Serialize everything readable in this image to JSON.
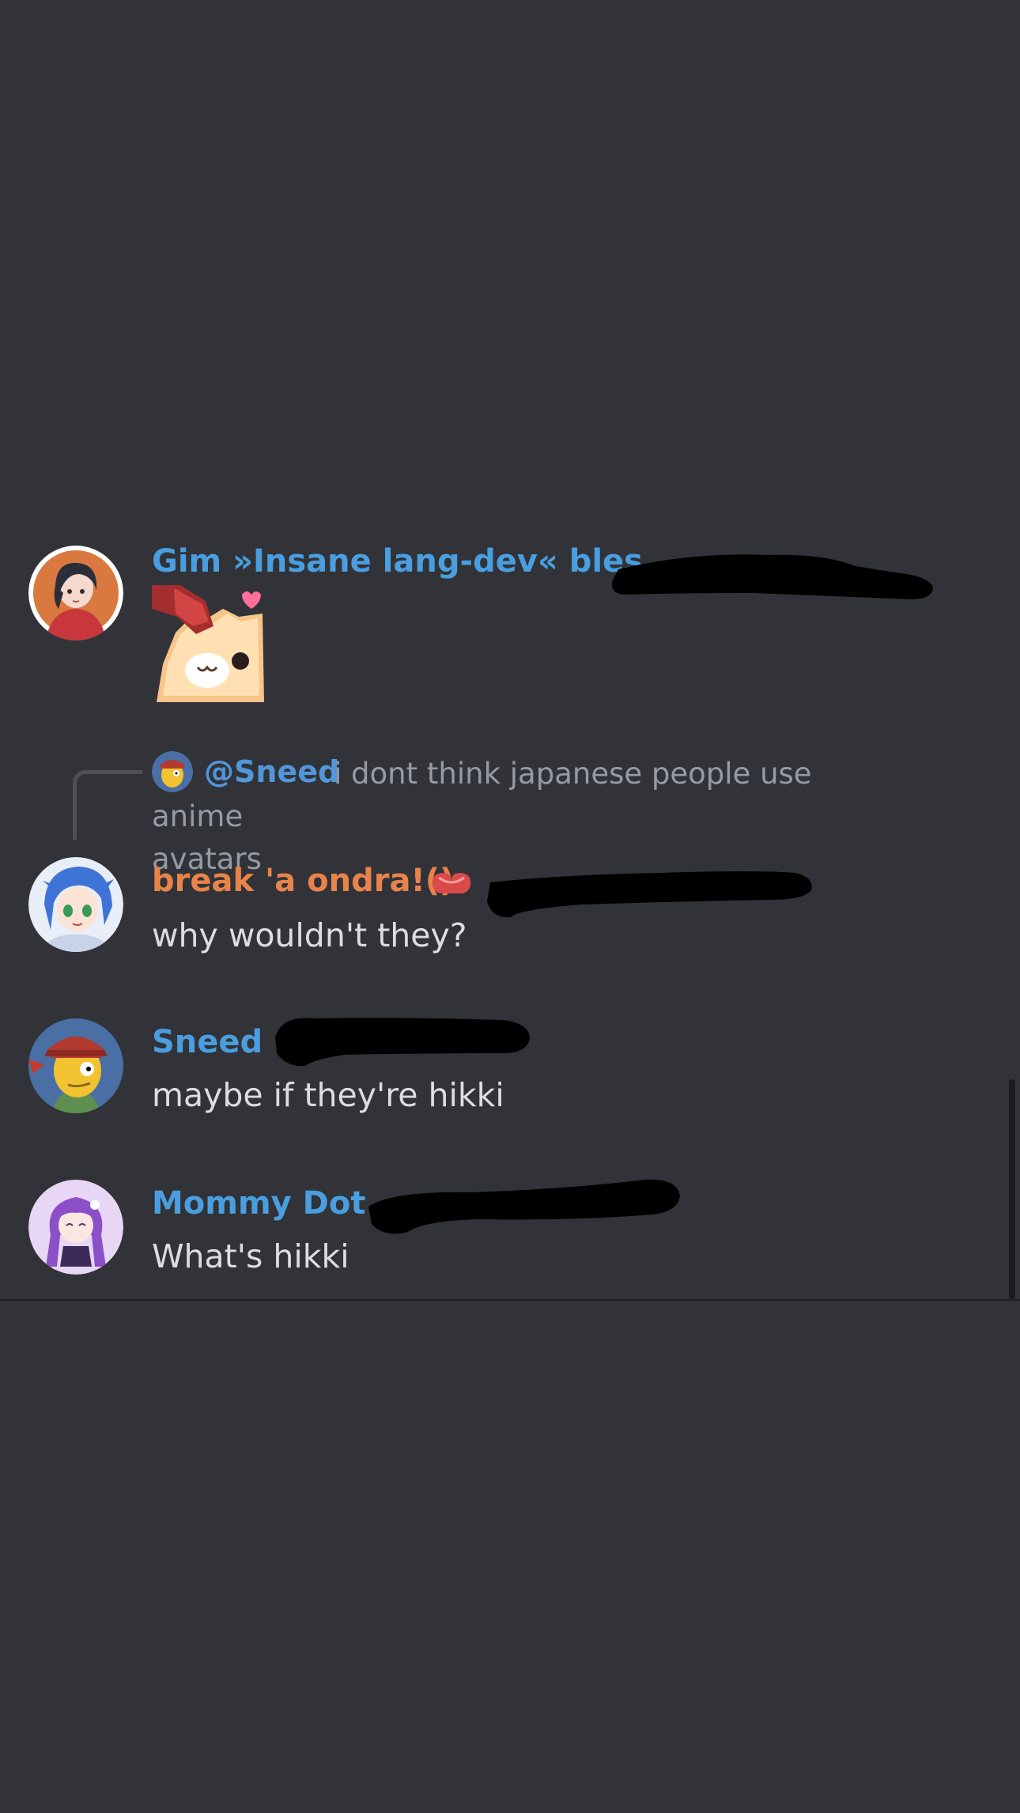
{
  "colors": {
    "background": "#313338",
    "username_blue": "#4a9ee0",
    "username_orange": "#e8834a",
    "message_text": "#dbdee1",
    "muted_text": "#949ba4",
    "mention_blue": "#5196d9"
  },
  "messages": [
    {
      "username": "Gim »Insane lang-dev« bles",
      "avatar_icon": "anime-girl-red-hoodie-avatar",
      "attachment": "headpat-fox-sticker"
    },
    {
      "reply": {
        "mention": "@Sneed",
        "preview_line1": "i dont think japanese people use anime",
        "preview_line2": "avatars"
      },
      "username": "break 'a ondra!()",
      "badge_icon": "red-heart-hands-emoji",
      "avatar_icon": "blue-hair-anime-girl-avatar",
      "text": "why wouldn't they?"
    },
    {
      "username": "Sneed",
      "avatar_icon": "cartoon-farmer-avatar",
      "text": "maybe if they're hikki"
    },
    {
      "username": "Mommy Dot",
      "avatar_icon": "purple-hair-chibi-avatar",
      "text": "What's hikki"
    }
  ]
}
